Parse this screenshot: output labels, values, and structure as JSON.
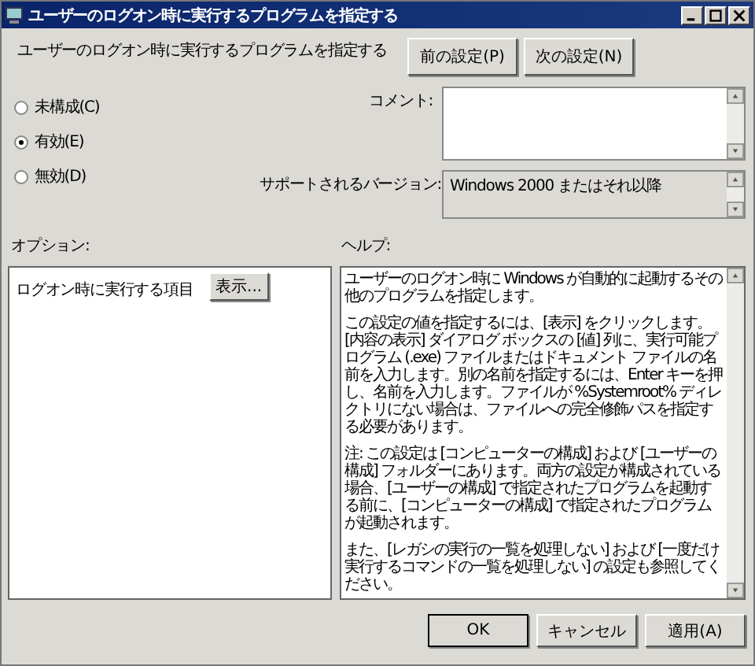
{
  "window": {
    "title": "ユーザーのログオン時に実行するプログラムを指定する"
  },
  "header": {
    "title": "ユーザーのログオン時に実行するプログラムを指定する",
    "buttons": [
      "前の設定(P)",
      "次の設定(N)"
    ]
  },
  "states": [
    {
      "label": "未構成(C)",
      "selected": false
    },
    {
      "label": "有効(E)",
      "selected": true
    },
    {
      "label": "無効(D)",
      "selected": false
    }
  ],
  "comment": {
    "label": "コメント:"
  },
  "supported": {
    "label": "サポートされるバージョン:",
    "value": "Windows 2000 またはそれ以降"
  },
  "options": {
    "label": "オプション:",
    "item": "ログオン時に実行する項目",
    "button": "表示..."
  },
  "help": {
    "label": "ヘルプ:",
    "paragraphs": [
      "ユーザーのログオン時に Windows が自動的に起動するその他のプログラムを指定します。",
      "この設定の値を指定するには、[表示] をクリックします。[内容の表示] ダイアログ ボックスの [値] 列に、実行可能プログラム (.exe) ファイルまたはドキュメント ファイルの名前を入力します。別の名前を指定するには、Enter キーを押し、名前を入力します。ファイルが %Systemroot% ディレクトリにない場合は、ファイルへの完全修飾パスを指定する必要があります。",
      "注: この設定は [コンピューターの構成] および [ユーザーの構成] フォルダーにあります。両方の設定が構成されている場合、[ユーザーの構成] で指定されたプログラムを起動する前に、[コンピューターの構成] で指定されたプログラムが起動されます。",
      "また、[レガシの実行の一覧を処理しない] および [一度だけ実行するコマンドの一覧を処理しない] の設定も参照してください。"
    ]
  },
  "buttons": [
    "OK",
    "キャンセル",
    "適用(A)"
  ]
}
